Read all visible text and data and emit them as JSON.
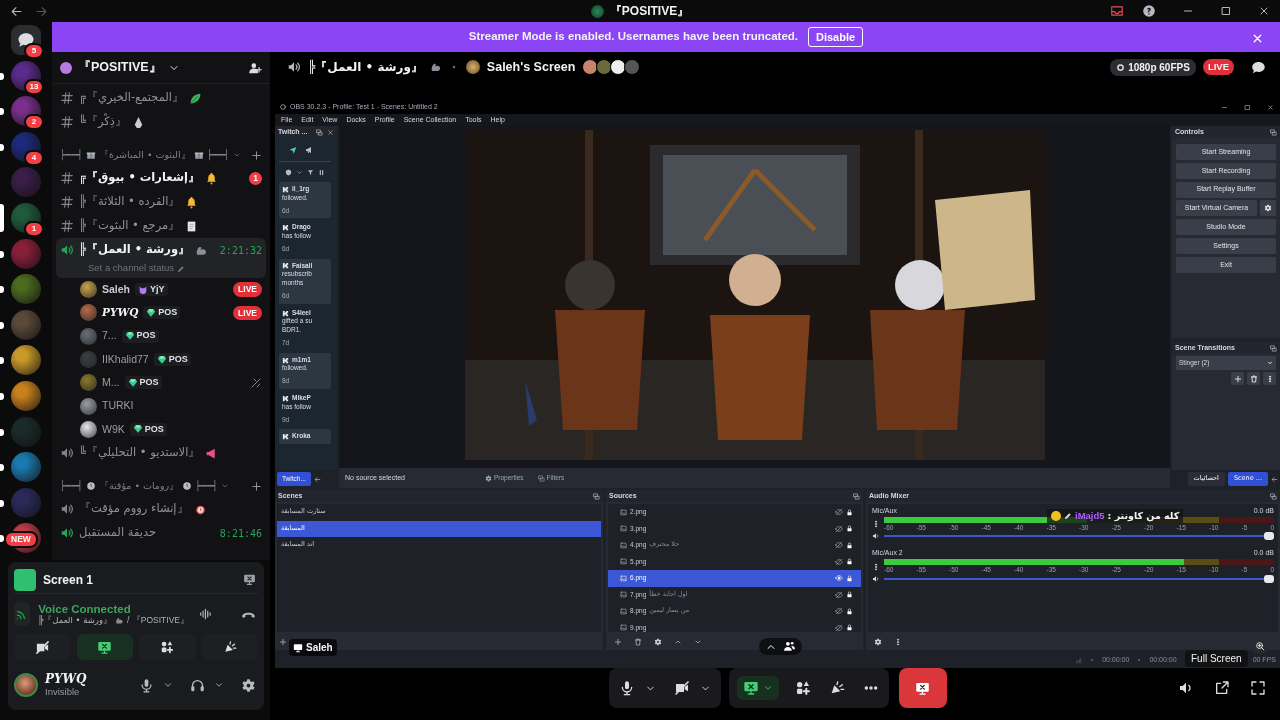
{
  "titlebar": {
    "title": "『POSITIVE』"
  },
  "banner": {
    "text": "Streamer Mode is enabled. Usernames have been truncated.",
    "button": "Disable"
  },
  "servers": [
    {
      "kind": "home",
      "badge": "5",
      "unread": false,
      "selected": false
    },
    {
      "kind": "server",
      "badge": "13",
      "unread": true,
      "selected": false
    },
    {
      "kind": "server",
      "badge": "2",
      "unread": true,
      "selected": false
    },
    {
      "kind": "server",
      "badge": "4",
      "unread": true,
      "selected": false
    },
    {
      "kind": "server",
      "unread": false,
      "selected": false
    },
    {
      "kind": "server",
      "badge": "1",
      "unread": false,
      "selected": true
    },
    {
      "kind": "server",
      "unread": true,
      "selected": false
    },
    {
      "kind": "server",
      "unread": true,
      "selected": false
    },
    {
      "kind": "server",
      "unread": true,
      "selected": false
    },
    {
      "kind": "server",
      "unread": true,
      "selected": false
    },
    {
      "kind": "server",
      "unread": true,
      "selected": false
    },
    {
      "kind": "server",
      "unread": true,
      "selected": false
    },
    {
      "kind": "server",
      "unread": true,
      "selected": false
    },
    {
      "kind": "server",
      "unread": true,
      "selected": false
    },
    {
      "kind": "new",
      "badge": "NEW",
      "unread": true,
      "selected": false
    }
  ],
  "sidebar": {
    "server_name": "『POSITIVE』",
    "channels": [
      {
        "kind": "text",
        "name": "╔『المجتمع-الخيري』",
        "unread": false
      },
      {
        "kind": "text",
        "name": "╚『ذِكْر』",
        "unread": false
      },
      {
        "kind": "category",
        "name": "『البثوت • المباشرة』",
        "deco_left": "┝━━┥",
        "deco_right": "┝━━┥"
      },
      {
        "kind": "text",
        "name": "╔『إشعارات • بيوق』",
        "unread": true,
        "badge": "1"
      },
      {
        "kind": "text",
        "name": "╠『القرده • الثلاثة』",
        "unread": false
      },
      {
        "kind": "text",
        "name": "╠『مرجع • البثوت』",
        "unread": false
      },
      {
        "kind": "voice",
        "name": "╠『ورشة • العمل』",
        "active": true,
        "selected": true,
        "time": "2:21:32",
        "status": "Set a channel status",
        "members": [
          {
            "name": "Saleh",
            "kind": "bold",
            "tag": "YjY",
            "live": "LIVE",
            "muted": false
          },
          {
            "name": "PYWQ",
            "kind": "serif",
            "tag": "POS",
            "live": "LIVE",
            "muted": false
          },
          {
            "name": "7...",
            "kind": "plain",
            "tag": "POS",
            "muted": false
          },
          {
            "name": "IIKhalid77",
            "kind": "plain",
            "tag": "POS",
            "muted": false
          },
          {
            "name": "M...",
            "kind": "plain",
            "tag": "POS",
            "muted": true
          },
          {
            "name": "TURKI",
            "kind": "plain",
            "muted": false
          },
          {
            "name": "W9K",
            "kind": "plain",
            "tag": "POS",
            "muted": false
          }
        ]
      },
      {
        "kind": "voice",
        "name": "╚『الاستديو • التحليلي』",
        "active": false,
        "selected": false
      },
      {
        "kind": "category",
        "name": "『رومات • مؤقتة』",
        "deco_left": "┝━━┥",
        "deco_right": "┝━━┥"
      },
      {
        "kind": "voice",
        "name": "『إنشاء رووم مؤقت』",
        "active": false,
        "selected": false
      },
      {
        "kind": "voice",
        "name": "حديقة المستقبل",
        "active": true,
        "selected": false,
        "time": "8:21:46"
      }
    ]
  },
  "voice_panel": {
    "screen": "Screen 1",
    "status": "Voice Connected",
    "channel": "╠『ورشة • العمل』",
    "server": "/ 『POSITIVE』",
    "video_on": false,
    "screen_share_on": true
  },
  "user": {
    "name": "PYWQ",
    "status": "Invisible"
  },
  "stream_header": {
    "channel": "╠『ورشة • العمل』",
    "title": "Saleh's Screen",
    "quality": "1080p 60FPS",
    "live": "LIVE"
  },
  "obs": {
    "title": "OBS 30.2.3 - Profile: Test 1 - Scenes: Untitled 2",
    "menu": [
      "File",
      "Edit",
      "View",
      "Docks",
      "Profile",
      "Scene Collection",
      "Tools",
      "Help"
    ],
    "twitch_dock": {
      "title": "Twitch ...",
      "tab": "Twitch...",
      "events": [
        {
          "user": "ii_1rg",
          "lines": [
            "followed."
          ],
          "time": "6d",
          "highlight": true
        },
        {
          "user": "Drago",
          "lines": [
            "has follow"
          ],
          "time": "6d",
          "highlight": false
        },
        {
          "user": "Faisall",
          "lines": [
            "resubscrib",
            "months"
          ],
          "time": "6d",
          "highlight": true
        },
        {
          "user": "S4leel",
          "lines": [
            "gifted a su",
            "BDR1."
          ],
          "time": "7d",
          "highlight": false
        },
        {
          "user": "m1m1",
          "lines": [
            "followed."
          ],
          "time": "8d",
          "highlight": true
        },
        {
          "user": "MikeP",
          "lines": [
            "has follow"
          ],
          "time": "9d",
          "highlight": false
        },
        {
          "user": "Kroka",
          "highlight": true
        }
      ]
    },
    "source_bar": {
      "label": "No source selected",
      "properties": "Properties",
      "filters": "Filters"
    },
    "controls": {
      "title": "Controls",
      "buttons": [
        "Start Streaming",
        "Start Recording",
        "Start Replay Buffer",
        "Start Virtual Camera",
        "Studio Mode",
        "Settings",
        "Exit"
      ]
    },
    "transitions": {
      "title": "Scene Transitions",
      "selected": "Stinger (2)"
    },
    "right_tabs": [
      {
        "label": "احصائيات",
        "selected": false
      },
      {
        "label": "Scene ...",
        "selected": true
      }
    ],
    "scenes": {
      "title": "Scenes",
      "items": [
        {
          "name": "ستارت المسابقة",
          "selected": false
        },
        {
          "name": "المسابقة",
          "selected": true
        },
        {
          "name": "اند المسابقة",
          "selected": false
        }
      ]
    },
    "sources": {
      "title": "Sources",
      "items": [
        {
          "name": "2.png",
          "selected": false,
          "visible": false
        },
        {
          "name": "3.png",
          "selected": false,
          "visible": false
        },
        {
          "name": "4.png",
          "note": "حلا محترف",
          "selected": false,
          "visible": false
        },
        {
          "name": "5.png",
          "selected": false,
          "visible": false
        },
        {
          "name": "6.png",
          "selected": true,
          "visible": true
        },
        {
          "name": "7.png",
          "note": "اول اجابة خطأ",
          "selected": false,
          "visible": false
        },
        {
          "name": "8.png",
          "note": "من يسار ليمين",
          "selected": false,
          "visible": false
        },
        {
          "name": "9.png",
          "selected": false,
          "visible": false
        }
      ]
    },
    "mixer": {
      "title": "Audio Mixer",
      "channels": [
        {
          "name": "Mic/Aux",
          "reading": "0.0 dB",
          "meter": {
            "level": 0.52
          },
          "fader": {
            "level": 1
          },
          "scale": [
            "-60",
            "-55",
            "-50",
            "-45",
            "-40",
            "-35",
            "-30",
            "-25",
            "-20",
            "-15",
            "-10",
            "-5",
            "0"
          ]
        },
        {
          "name": "Mic/Aux 2",
          "reading": "0.0 dB",
          "meter": {
            "level": 0.77
          },
          "fader": {
            "level": 1
          },
          "scale": [
            "-60",
            "-55",
            "-50",
            "-45",
            "-40",
            "-35",
            "-30",
            "-25",
            "-20",
            "-15",
            "-10",
            "-5",
            "0"
          ]
        }
      ]
    },
    "status": {
      "times": [
        "00:00:00",
        "00:00:00"
      ],
      "fps": "00 FPS"
    }
  },
  "overlay": {
    "streamer": "Saleh",
    "tooltip": "Full Screen",
    "chat": {
      "user": "iMajd5",
      "message": ": كله من كاونتر"
    }
  },
  "call_controls": {
    "video_on": false,
    "screen_share_on": true
  }
}
